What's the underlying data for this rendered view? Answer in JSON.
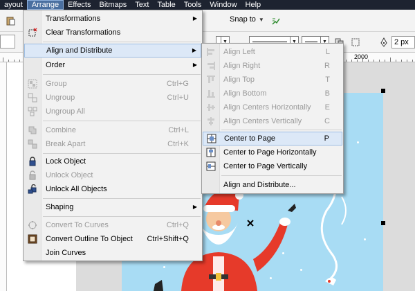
{
  "menubar": {
    "items": [
      "ayout",
      "Arrange",
      "Effects",
      "Bitmaps",
      "Text",
      "Table",
      "Tools",
      "Window",
      "Help"
    ],
    "active": "Arrange"
  },
  "toolbar": {
    "snap_label": "Snap to",
    "size_value": "2 px"
  },
  "ruler": {
    "label": "2000"
  },
  "arrange_menu": {
    "items": [
      {
        "label": "Transformations",
        "shortcut": "",
        "submenu": true,
        "disabled": false
      },
      {
        "label": "Clear Transformations",
        "shortcut": "",
        "submenu": false,
        "disabled": false
      },
      {
        "label": "Align and Distribute",
        "shortcut": "",
        "submenu": true,
        "disabled": false
      },
      {
        "label": "Order",
        "shortcut": "",
        "submenu": true,
        "disabled": false
      },
      {
        "label": "Group",
        "shortcut": "Ctrl+G",
        "submenu": false,
        "disabled": true
      },
      {
        "label": "Ungroup",
        "shortcut": "Ctrl+U",
        "submenu": false,
        "disabled": true
      },
      {
        "label": "Ungroup All",
        "shortcut": "",
        "submenu": false,
        "disabled": true
      },
      {
        "label": "Combine",
        "shortcut": "Ctrl+L",
        "submenu": false,
        "disabled": true
      },
      {
        "label": "Break  Apart",
        "shortcut": "Ctrl+K",
        "submenu": false,
        "disabled": true
      },
      {
        "label": "Lock Object",
        "shortcut": "",
        "submenu": false,
        "disabled": false
      },
      {
        "label": "Unlock Object",
        "shortcut": "",
        "submenu": false,
        "disabled": true
      },
      {
        "label": "Unlock All Objects",
        "shortcut": "",
        "submenu": false,
        "disabled": false
      },
      {
        "label": "Shaping",
        "shortcut": "",
        "submenu": true,
        "disabled": false
      },
      {
        "label": "Convert To Curves",
        "shortcut": "Ctrl+Q",
        "submenu": false,
        "disabled": true
      },
      {
        "label": "Convert Outline To Object",
        "shortcut": "Ctrl+Shift+Q",
        "submenu": false,
        "disabled": false
      },
      {
        "label": "Join Curves",
        "shortcut": "",
        "submenu": false,
        "disabled": false
      }
    ]
  },
  "align_submenu": {
    "items": [
      {
        "label": "Align Left",
        "shortcut": "L",
        "disabled": true
      },
      {
        "label": "Align Right",
        "shortcut": "R",
        "disabled": true
      },
      {
        "label": "Align Top",
        "shortcut": "T",
        "disabled": true
      },
      {
        "label": "Align Bottom",
        "shortcut": "B",
        "disabled": true
      },
      {
        "label": "Align Centers Horizontally",
        "shortcut": "E",
        "disabled": true
      },
      {
        "label": "Align Centers Vertically",
        "shortcut": "C",
        "disabled": true
      },
      {
        "label": "Center to Page",
        "shortcut": "P",
        "disabled": false
      },
      {
        "label": "Center to Page Horizontally",
        "shortcut": "",
        "disabled": false
      },
      {
        "label": "Center to Page Vertically",
        "shortcut": "",
        "disabled": false
      },
      {
        "label": "Align and Distribute...",
        "shortcut": "",
        "disabled": false
      }
    ]
  },
  "colors": {
    "menubar_bg": "#1d2330",
    "highlight_bg": "#dce8f7",
    "artwork_bg": "#a8dcf4"
  }
}
